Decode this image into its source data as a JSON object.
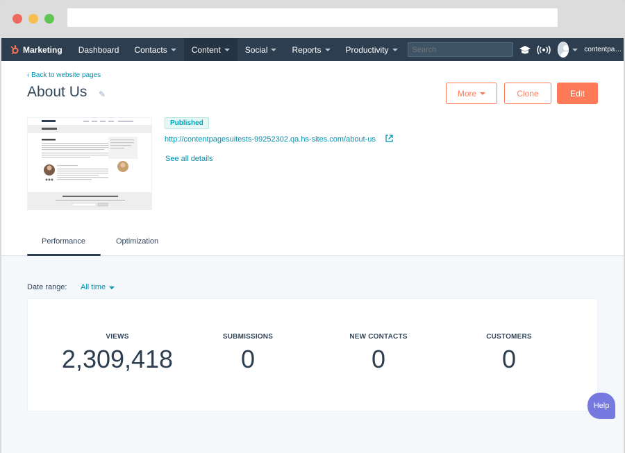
{
  "nav": {
    "brand": "Marketing",
    "items": [
      {
        "label": "Dashboard",
        "caret": false,
        "active": false
      },
      {
        "label": "Contacts",
        "caret": true,
        "active": false
      },
      {
        "label": "Content",
        "caret": true,
        "active": true
      },
      {
        "label": "Social",
        "caret": true,
        "active": false
      },
      {
        "label": "Reports",
        "caret": true,
        "active": false
      },
      {
        "label": "Productivity",
        "caret": true,
        "active": false
      }
    ],
    "search_placeholder": "Search",
    "account": "contentpagesuit..."
  },
  "header": {
    "back_link": "Back to website pages",
    "title": "About Us",
    "buttons": {
      "more": "More",
      "clone": "Clone",
      "edit": "Edit"
    }
  },
  "page_info": {
    "status": "Published",
    "url": "http://contentpagesuitests-99252302.qa.hs-sites.com/about-us",
    "details_link": "See all details"
  },
  "tabs": {
    "performance": "Performance",
    "optimization": "Optimization"
  },
  "performance": {
    "date_range_label": "Date range:",
    "date_range_value": "All time",
    "stats": [
      {
        "label": "VIEWS",
        "value": "2,309,418"
      },
      {
        "label": "SUBMISSIONS",
        "value": "0"
      },
      {
        "label": "NEW CONTACTS",
        "value": "0"
      },
      {
        "label": "CUSTOMERS",
        "value": "0"
      }
    ]
  },
  "help": "Help",
  "colors": {
    "accent": "#ff7a59",
    "link": "#0091ae",
    "nav_bg": "#2d3e50",
    "help_bg": "#7579e0"
  },
  "icons": [
    "sprocket-icon",
    "academy-icon",
    "broadcast-icon",
    "pencil-icon",
    "external-link-icon",
    "back-chevron-icon"
  ]
}
